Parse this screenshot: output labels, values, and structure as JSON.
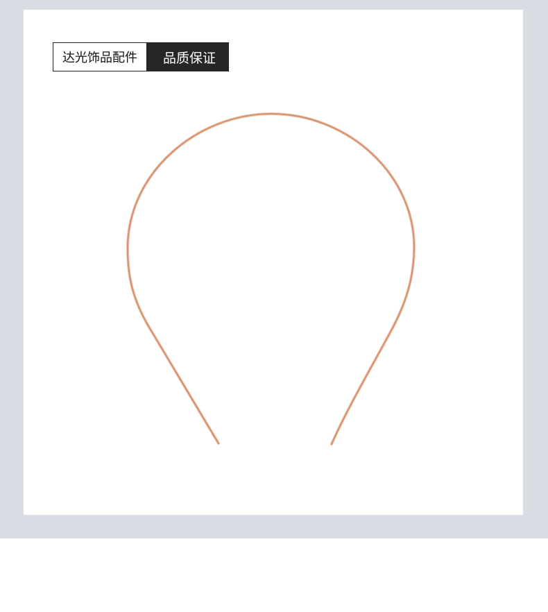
{
  "badge": {
    "brand_label": "达光饰品配件",
    "quality_label": "品质保证"
  },
  "product": {
    "name": "headband-wire",
    "color": "#d89a7c"
  },
  "colors": {
    "frame_background": "#d9dce3",
    "card_background": "#ffffff",
    "badge_dark": "#262626"
  }
}
